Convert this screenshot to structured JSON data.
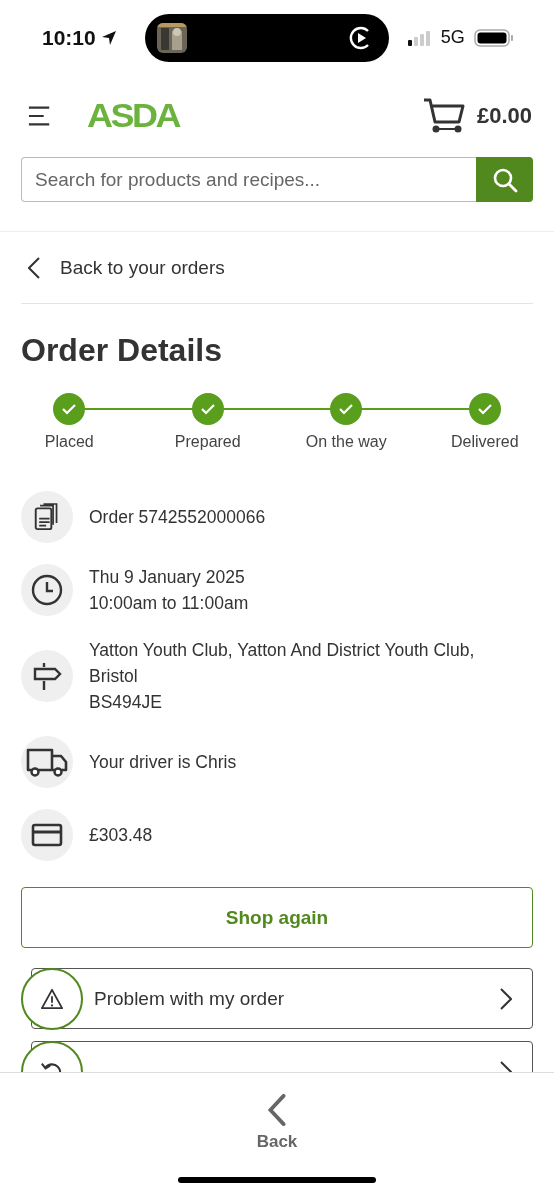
{
  "status_bar": {
    "time": "10:10",
    "network": "5G"
  },
  "header": {
    "logo": "ASDA",
    "basket_total": "£0.00"
  },
  "search": {
    "placeholder": "Search for products and recipes..."
  },
  "back_link": "Back to your orders",
  "title": "Order Details",
  "steps": [
    {
      "label": "Placed",
      "done": true
    },
    {
      "label": "Prepared",
      "done": true
    },
    {
      "label": "On the way",
      "done": true
    },
    {
      "label": "Delivered",
      "done": true
    }
  ],
  "details": [
    {
      "kind": "order",
      "lines": [
        "Order 5742552000066"
      ]
    },
    {
      "kind": "time",
      "lines": [
        "Thu 9 January 2025",
        "10:00am to 11:00am"
      ]
    },
    {
      "kind": "address",
      "lines": [
        "Yatton Youth Club, Yatton And District Youth Club,",
        "Bristol",
        "BS494JE"
      ]
    },
    {
      "kind": "driver",
      "lines": [
        "Your driver is Chris"
      ]
    },
    {
      "kind": "payment",
      "lines": [
        "£303.48"
      ]
    }
  ],
  "shop_again": "Shop again",
  "actions": [
    {
      "kind": "problem",
      "label": "Problem with my order"
    },
    {
      "kind": "refund"
    }
  ],
  "bottom_bar": {
    "back": "Back"
  }
}
